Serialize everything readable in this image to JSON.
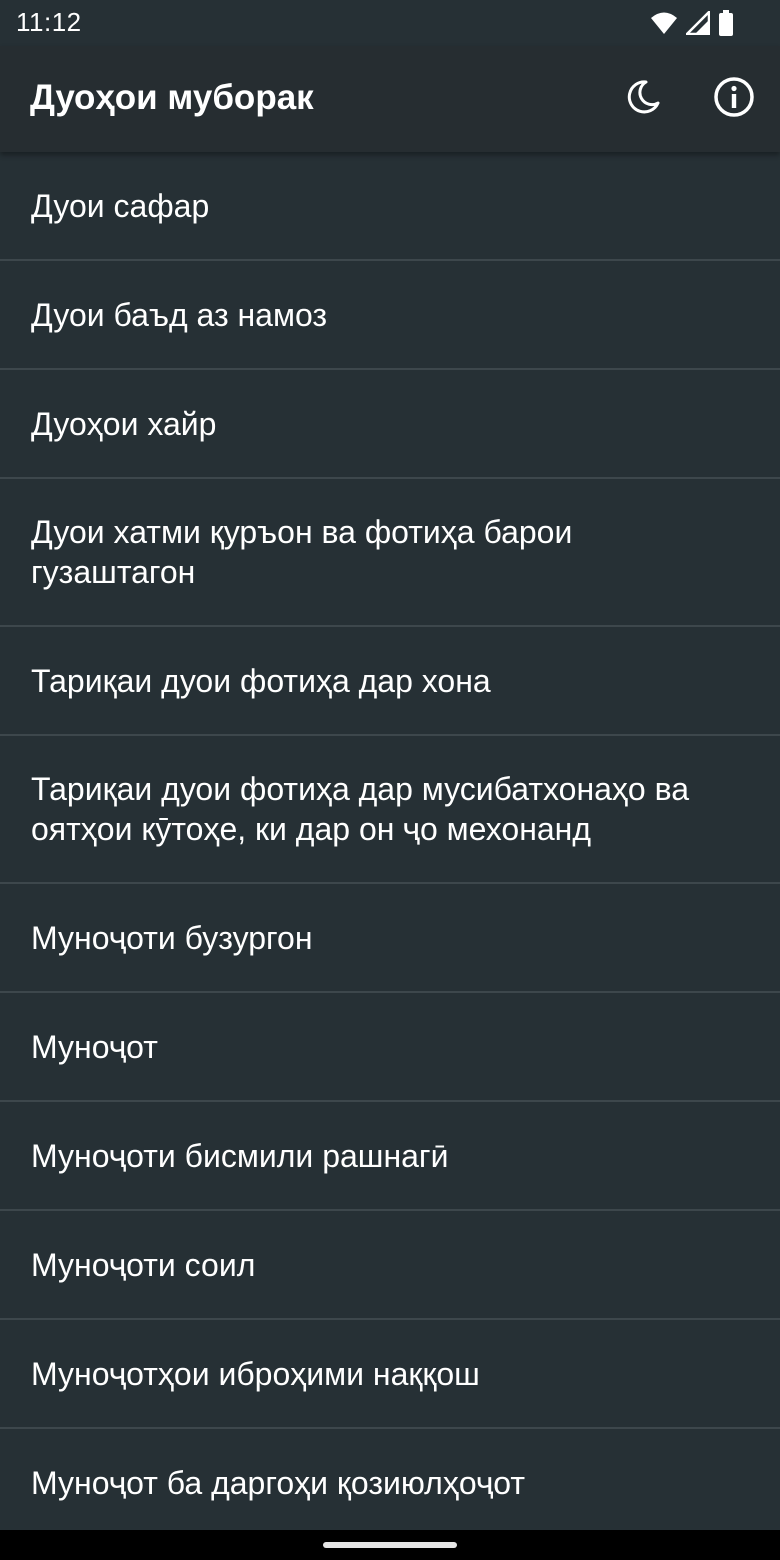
{
  "status_bar": {
    "time": "11:12",
    "icons": [
      "wifi-icon",
      "cellular-signal-icon",
      "battery-icon"
    ]
  },
  "app_bar": {
    "title": "Дуоҳои муборак",
    "actions": [
      "night-mode-icon",
      "info-icon"
    ]
  },
  "list": {
    "items": [
      {
        "label": "Дуои сафар"
      },
      {
        "label": "Дуои баъд аз намоз"
      },
      {
        "label": "Дуоҳои хайр"
      },
      {
        "label": "Дуои хатми қуръон ва фотиҳа барои гузаштагон"
      },
      {
        "label": "Тариқаи дуои фотиҳа дар хона"
      },
      {
        "label": "Тариқаи дуои фотиҳа дар мусибатхонаҳо ва оятҳои кӯтоҳе, ки дар он ҷо мехонанд"
      },
      {
        "label": "Муноҷоти бузургон"
      },
      {
        "label": "Муноҷот"
      },
      {
        "label": "Муноҷоти бисмили рашнагӣ"
      },
      {
        "label": "Муноҷоти соил"
      },
      {
        "label": "Муноҷотҳои иброҳими наққош"
      },
      {
        "label": "Муноҷот ба даргоҳи қозиюлҳоҷот"
      }
    ]
  },
  "colors": {
    "background": "#263035",
    "app_bar": "#262d31",
    "divider": "#3d474c",
    "text": "#ffffff"
  }
}
